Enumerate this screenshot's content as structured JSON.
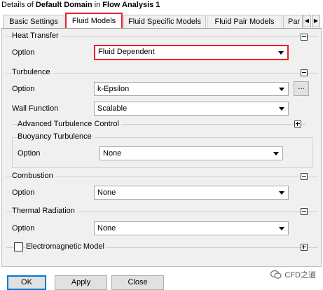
{
  "header": {
    "prefix": "Details of ",
    "object": "Default Domain",
    "middle": " in ",
    "analysis": "Flow Analysis 1"
  },
  "tabs": [
    {
      "label": "Basic Settings"
    },
    {
      "label": "Fluid Models"
    },
    {
      "label": "Fluid Specific Models"
    },
    {
      "label": "Fluid Pair Models"
    },
    {
      "label": "Par"
    }
  ],
  "active_tab": "Fluid Models",
  "heat_transfer": {
    "title": "Heat Transfer",
    "option_label": "Option",
    "option_value": "Fluid Dependent"
  },
  "turbulence": {
    "title": "Turbulence",
    "option_label": "Option",
    "option_value": "k-Epsilon",
    "more_label": "...",
    "wall_function_label": "Wall Function",
    "wall_function_value": "Scalable",
    "advanced_label": "Advanced Turbulence Control",
    "buoyancy": {
      "title": "Buoyancy Turbulence",
      "option_label": "Option",
      "option_value": "None"
    }
  },
  "combustion": {
    "title": "Combustion",
    "option_label": "Option",
    "option_value": "None"
  },
  "thermal_radiation": {
    "title": "Thermal Radiation",
    "option_label": "Option",
    "option_value": "None"
  },
  "electromagnetic": {
    "label": "Electromagnetic Model",
    "checked": false
  },
  "buttons": {
    "ok": "OK",
    "apply": "Apply",
    "close": "Close"
  },
  "watermark": "CFD之道",
  "colors": {
    "highlight": "#e8222a",
    "panel_bg": "#f0f0f0",
    "default_button_border": "#0078d7"
  }
}
